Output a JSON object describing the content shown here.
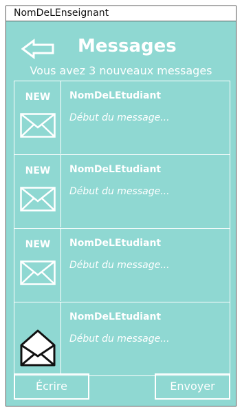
{
  "window": {
    "title": "NomDeLEnseignant"
  },
  "header": {
    "back_icon": "arrow-left-icon",
    "title": "Messages"
  },
  "subtitle": "Vous avez 3 nouveaux messages",
  "messages": [
    {
      "badge": "NEW",
      "icon": "envelope-closed-icon",
      "sender": "NomDeLEtudiant",
      "preview": "Début du message..."
    },
    {
      "badge": "NEW",
      "icon": "envelope-closed-icon",
      "sender": "NomDeLEtudiant",
      "preview": "Début du message..."
    },
    {
      "badge": "NEW",
      "icon": "envelope-closed-icon",
      "sender": "NomDeLEtudiant",
      "preview": "Début du message..."
    },
    {
      "badge": "",
      "icon": "envelope-open-icon",
      "sender": "NomDeLEtudiant",
      "preview": "Début du message..."
    }
  ],
  "actions": {
    "write_label": "Écrire",
    "send_label": "Envoyer"
  },
  "colors": {
    "background": "#8fd8d2",
    "foreground": "#ffffff"
  }
}
